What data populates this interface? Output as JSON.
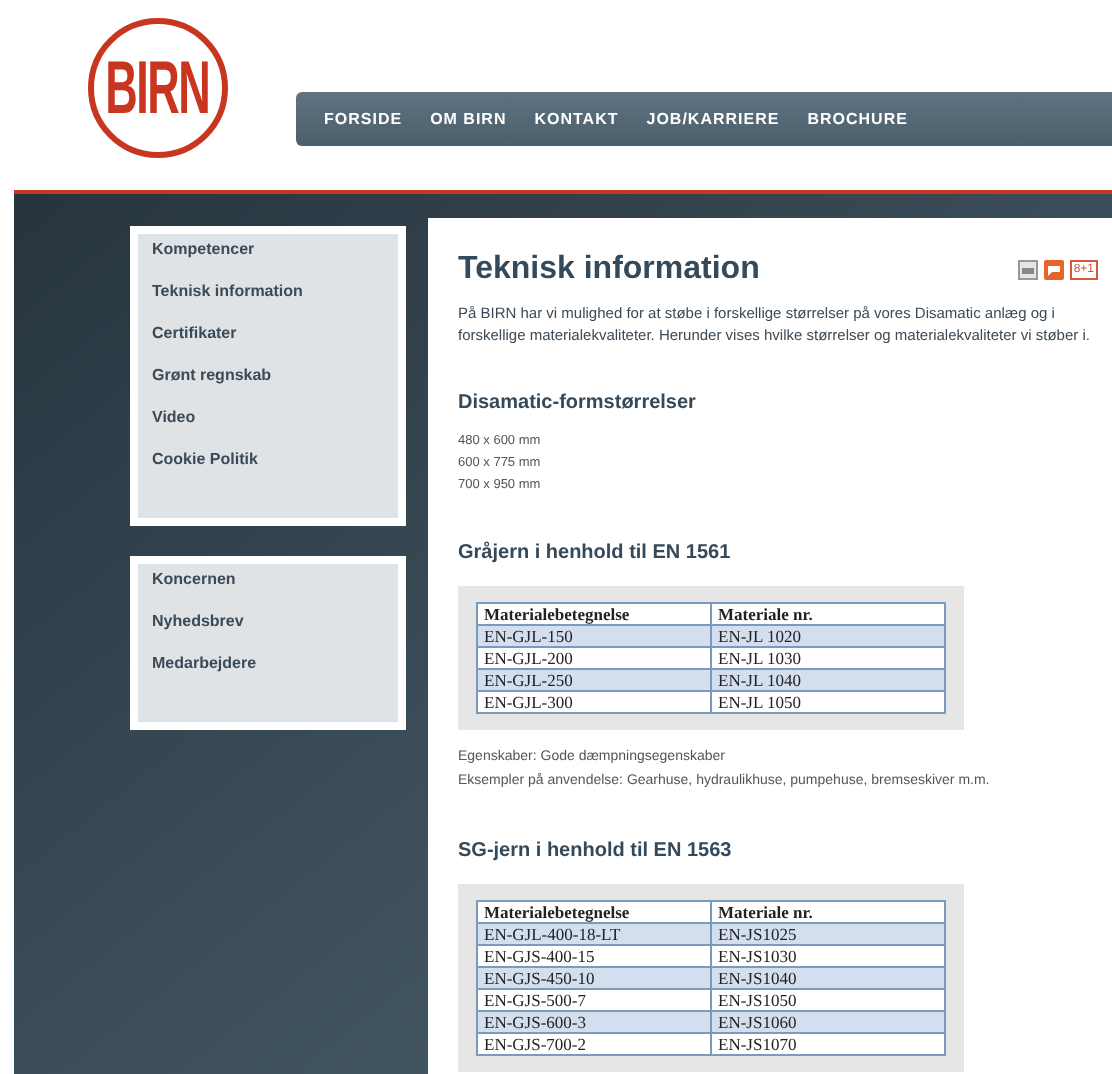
{
  "logo": {
    "text": "BIRN"
  },
  "nav": [
    "FORSIDE",
    "OM BIRN",
    "KONTAKT",
    "JOB/KARRIERE",
    "BROCHURE"
  ],
  "sidebar_menus": [
    [
      "Kompetencer",
      "Teknisk information",
      "Certifikater",
      "Grønt regnskab",
      "Video",
      "Cookie Politik"
    ],
    [
      "Koncernen",
      "Nyhedsbrev",
      "Medarbejdere"
    ]
  ],
  "content": {
    "title": "Teknisk information",
    "share_badge": "8+1",
    "intro": "På BIRN har vi mulighed for at støbe i forskellige størrelser på vores Disamatic anlæg og i forskellige materialekvaliteter. Herunder vises hvilke størrelser og materialekvaliteter vi støber i.",
    "sections": [
      {
        "kind": "list",
        "heading": "Disamatic-formstørrelser",
        "lines": [
          "480 x 600 mm",
          "600 x 775 mm",
          "700 x 950 mm"
        ]
      },
      {
        "kind": "table",
        "heading": "Gråjern i henhold til EN 1561",
        "columns": [
          "Materialebetegnelse",
          "Materiale nr."
        ],
        "rows": [
          [
            "EN-GJL-150",
            "EN-JL 1020"
          ],
          [
            "EN-GJL-200",
            "EN-JL 1030"
          ],
          [
            "EN-GJL-250",
            "EN-JL 1040"
          ],
          [
            "EN-GJL-300",
            "EN-JL 1050"
          ]
        ],
        "notes": [
          "Egenskaber: Gode dæmpningsegenskaber",
          "Eksempler på anvendelse: Gearhuse, hydraulikhuse, pumpehuse, bremseskiver m.m."
        ]
      },
      {
        "kind": "table",
        "heading": "SG-jern i henhold til EN 1563",
        "columns": [
          "Materialebetegnelse",
          "Materiale nr."
        ],
        "rows": [
          [
            "EN-GJL-400-18-LT",
            "EN-JS1025"
          ],
          [
            "EN-GJS-400-15",
            "EN-JS1030"
          ],
          [
            "EN-GJS-450-10",
            "EN-JS1040"
          ],
          [
            "EN-GJS-500-7",
            "EN-JS1050"
          ],
          [
            "EN-GJS-600-3",
            "EN-JS1060"
          ],
          [
            "EN-GJS-700-2",
            "EN-JS1070"
          ]
        ]
      }
    ]
  }
}
